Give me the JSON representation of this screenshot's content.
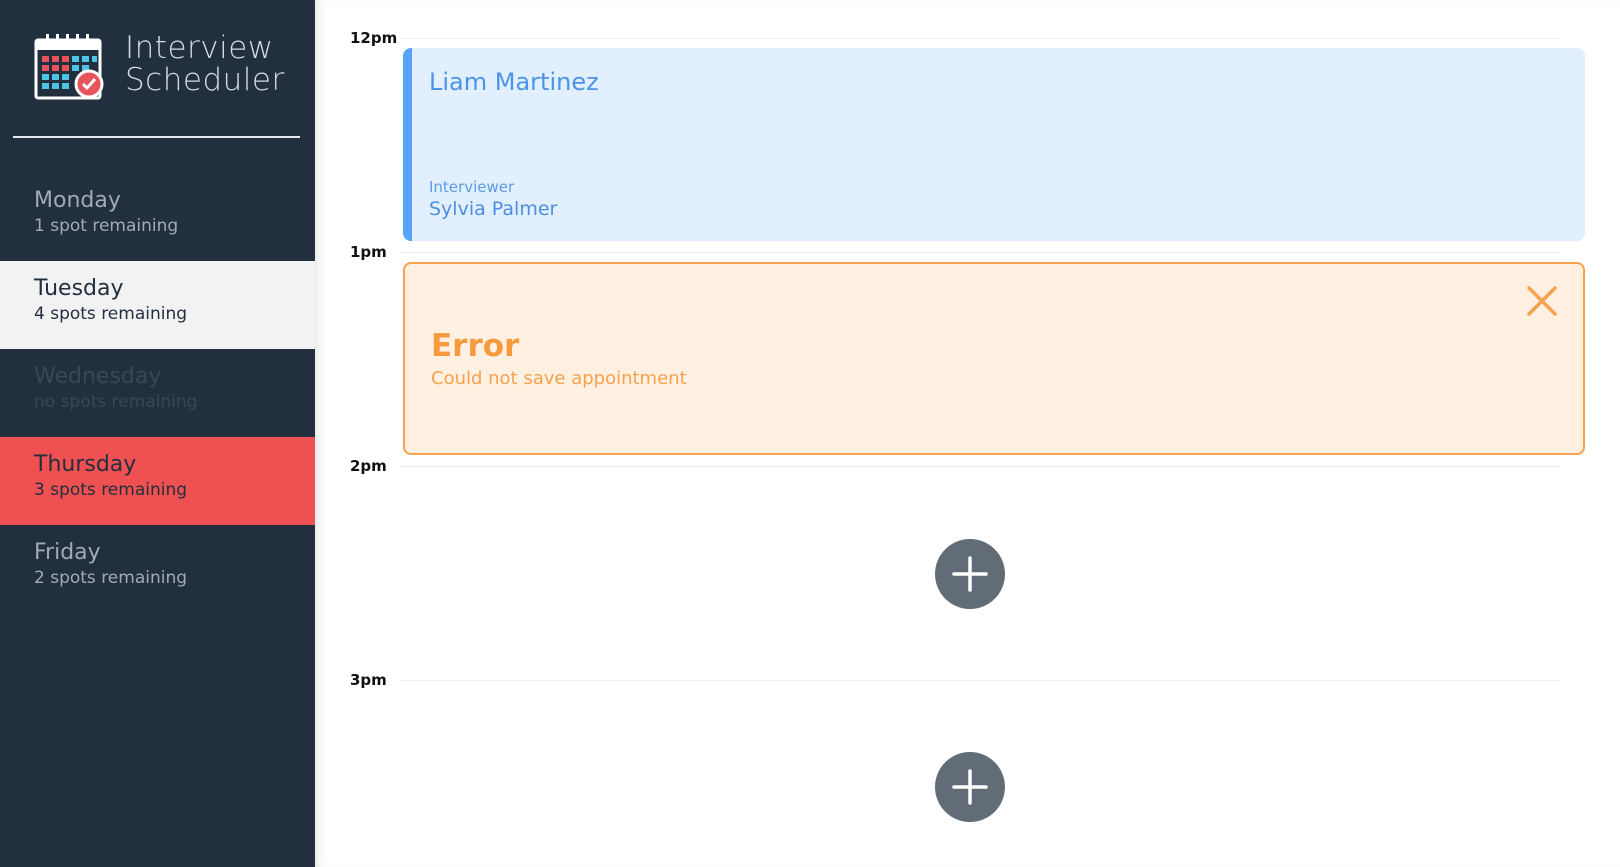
{
  "app": {
    "title": "Interview\nScheduler",
    "logo_icon": "calendar-check-icon"
  },
  "sidebar": {
    "days": [
      {
        "name": "Monday",
        "spots": "1 spot remaining",
        "state": "normal"
      },
      {
        "name": "Tuesday",
        "spots": "4 spots remaining",
        "state": "selected"
      },
      {
        "name": "Wednesday",
        "spots": "no spots remaining",
        "state": "full"
      },
      {
        "name": "Thursday",
        "spots": "3 spots remaining",
        "state": "hover"
      },
      {
        "name": "Friday",
        "spots": "2 spots remaining",
        "state": "normal"
      }
    ]
  },
  "schedule": {
    "times": [
      "12pm",
      "1pm",
      "2pm",
      "3pm"
    ],
    "appointment": {
      "student": "Liam Martinez",
      "interviewer_label": "Interviewer",
      "interviewer": "Sylvia Palmer"
    },
    "error": {
      "title": "Error",
      "message": "Could not save appointment",
      "close_icon": "close-icon"
    },
    "add_icon": "plus-icon"
  },
  "colors": {
    "sidebar_bg": "#222f3e",
    "selected_bg": "#f2f2f2",
    "hover_bg": "#ef5051",
    "appointment_bg": "#e1effe",
    "appointment_accent": "#55a4f7",
    "error_bg": "#fff0e2",
    "error_accent": "#f7a24d",
    "add_button": "#626c77"
  }
}
